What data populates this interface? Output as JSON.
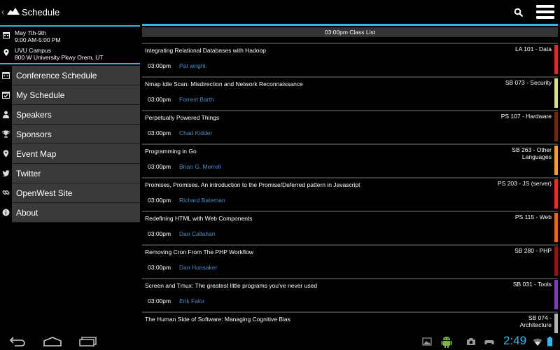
{
  "app": {
    "title": "Schedule",
    "icons": {
      "up": "chevron-left-icon",
      "logo": "mountain-logo-icon",
      "search": "search-icon",
      "menu": "menu-icon"
    }
  },
  "event": {
    "dates": "May 7th-9th",
    "hours": "9:00 AM-5:00 PM",
    "venue": "UVU Campus",
    "address": "800 W University Pkwy Orem, UT"
  },
  "nav": {
    "items": [
      {
        "label": "Conference Schedule",
        "icon": "calendar-icon"
      },
      {
        "label": "My Schedule",
        "icon": "calendar-check-icon"
      },
      {
        "label": "Speakers",
        "icon": "person-icon"
      },
      {
        "label": "Sponsors",
        "icon": "trophy-icon"
      },
      {
        "label": "Event Map",
        "icon": "map-pin-icon"
      },
      {
        "label": "Twitter",
        "icon": "twitter-icon"
      },
      {
        "label": "OpenWest Site",
        "icon": "link-icon"
      },
      {
        "label": "About",
        "icon": "info-icon"
      }
    ]
  },
  "list": {
    "header": "03:00pm Class List",
    "sessions": [
      {
        "title": "Integrating Relational Databases with Hadoop",
        "time": "03:00pm",
        "speaker": "Pat wright",
        "room": "LA 101 - Data",
        "color": "#d32f2f"
      },
      {
        "title": "Nmap Idle Scan: Misdirection and Network Reconnaissance",
        "time": "03:00pm",
        "speaker": "Forrest Barth",
        "room": "SB 073 - Security",
        "color": "#d9e08a"
      },
      {
        "title": "Perpetually Powered Things",
        "time": "03:00pm",
        "speaker": "Chad Kidder",
        "room": "PS 107 - Hardware",
        "color": "#6d2a14"
      },
      {
        "title": "Programming in Go",
        "time": "03:00pm",
        "speaker": "Brian G. Merrell",
        "room": "SB 263 - Other Languages",
        "color": "#f0a030"
      },
      {
        "title": "Promises, Promises. An introduction to the Promise/Deferred pattern in Javascript",
        "time": "03:00pm",
        "speaker": "Richard Bateman",
        "room": "PS 203 - JS (server)",
        "color": "#e03030"
      },
      {
        "title": "Redefining HTML with Web Components",
        "time": "03:00pm",
        "speaker": "Dan Callahan",
        "room": "PS 115 - Web",
        "color": "#e06a20"
      },
      {
        "title": "Removing Cron From The PHP Workflow",
        "time": "03:00pm",
        "speaker": "Dan Hunsaker",
        "room": "SB 280 - PHP",
        "color": "#8a1a1a"
      },
      {
        "title": "Screen and Tmux: The greatest little programs you've never used",
        "time": "03:00pm",
        "speaker": "Erik Falor",
        "room": "SB 031 - Tools",
        "color": "#7b3fb0"
      },
      {
        "title": "The Human Side of Software: Managing Cognitive Bias",
        "time": "",
        "speaker": "",
        "room": "SB 074 - Architecture",
        "color": "#b0b0b0"
      }
    ]
  },
  "system": {
    "time": "2:49",
    "icons": {
      "back": "back-icon",
      "home": "home-icon",
      "recent": "recent-apps-icon",
      "gallery": "gallery-icon",
      "android": "android-icon",
      "camera": "camera-icon",
      "game": "game-controller-icon",
      "wifi": "wifi-icon",
      "battery": "battery-icon"
    }
  }
}
